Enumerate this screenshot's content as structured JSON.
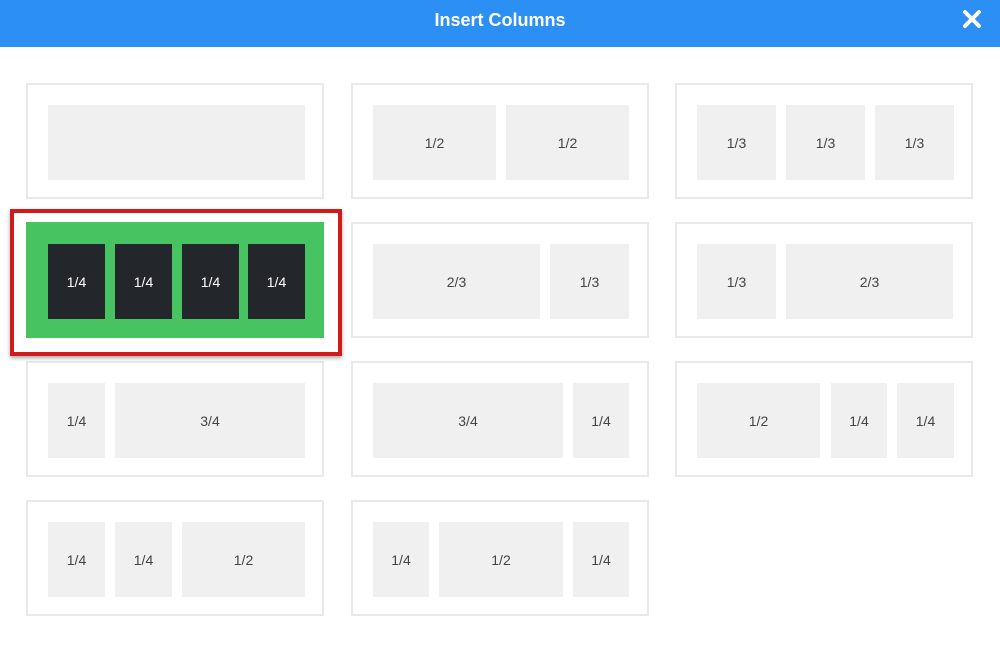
{
  "dialog": {
    "title": "Insert Columns",
    "close_icon": "close-icon",
    "header_color": "#2b8ff3"
  },
  "layouts": [
    {
      "columns": []
    },
    {
      "columns": [
        "1/2",
        "1/2"
      ]
    },
    {
      "columns": [
        "1/3",
        "1/3",
        "1/3"
      ]
    },
    {
      "columns": [
        "1/4",
        "1/4",
        "1/4",
        "1/4"
      ],
      "selected": true
    },
    {
      "columns": [
        "2/3",
        "1/3"
      ]
    },
    {
      "columns": [
        "1/3",
        "2/3"
      ]
    },
    {
      "columns": [
        "1/4",
        "3/4"
      ]
    },
    {
      "columns": [
        "3/4",
        "1/4"
      ]
    },
    {
      "columns": [
        "1/2",
        "1/4",
        "1/4"
      ]
    },
    {
      "columns": [
        "1/4",
        "1/4",
        "1/2"
      ]
    },
    {
      "columns": [
        "1/4",
        "1/2",
        "1/4"
      ]
    }
  ],
  "colors": {
    "selected_background": "#47c362",
    "selected_column": "#23272b",
    "column": "#f0f0f0",
    "highlight_border": "#d11a1a"
  }
}
